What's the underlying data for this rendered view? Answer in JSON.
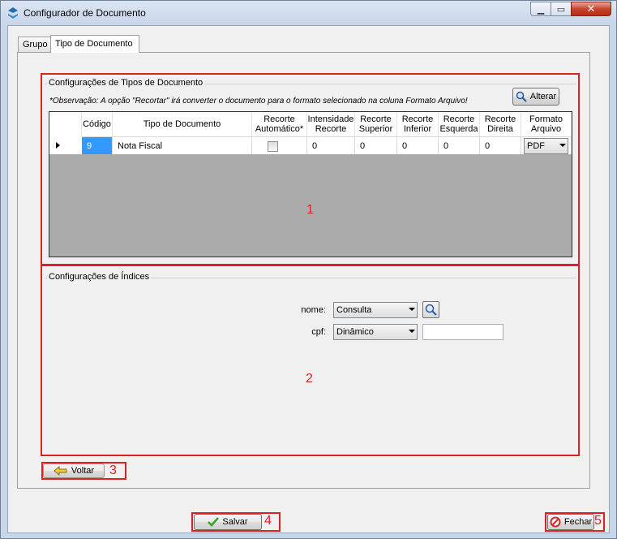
{
  "window": {
    "title": "Configurador de Documento",
    "close_glyph": "✕",
    "min_glyph": "▁",
    "max_glyph": "▭"
  },
  "tabs": [
    {
      "label": "Grupo"
    },
    {
      "label": "Tipo de Documento"
    }
  ],
  "doc_types": {
    "group_title": "Configurações de Tipos de Documento",
    "note": "*Observação: A opção \"Recortar\" irá converter o documento para o formato selecionado na coluna Formato Arquivo!",
    "alterar_label": "Alterar",
    "columns": [
      {
        "label": "Código"
      },
      {
        "label": "Tipo de Documento"
      },
      {
        "label": "Recorte Automático*"
      },
      {
        "label": "Intensidade Recorte"
      },
      {
        "label": "Recorte Superior"
      },
      {
        "label": "Recorte Inferior"
      },
      {
        "label": "Recorte Esquerda"
      },
      {
        "label": "Recorte Direita"
      },
      {
        "label": "Formato Arquivo"
      }
    ],
    "rows": [
      {
        "codigo": "9",
        "tipo": "Nota Fiscal",
        "recorte_auto": false,
        "intensidade": "0",
        "superior": "0",
        "inferior": "0",
        "esquerda": "0",
        "direita": "0",
        "formato": "PDF"
      }
    ]
  },
  "indices": {
    "group_title": "Configurações de Índices",
    "fields": [
      {
        "label": "nome:",
        "mode": "Consulta"
      },
      {
        "label": "cpf:",
        "mode": "Dinâmico",
        "value": ""
      }
    ]
  },
  "annotations": {
    "one": "1",
    "two": "2",
    "three": "3",
    "four": "4",
    "five": "5"
  },
  "buttons": {
    "voltar": "Voltar",
    "salvar": "Salvar",
    "fechar": "Fechar"
  },
  "colors": {
    "annotation_red": "#e02020",
    "selection_blue": "#3399ff"
  }
}
